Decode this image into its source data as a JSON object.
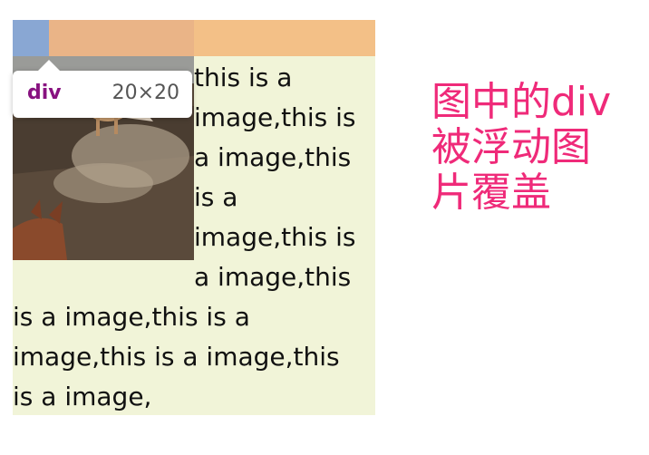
{
  "tooltip": {
    "tag": "div",
    "size": "20×20"
  },
  "paragraph_lines": [
    "this is a",
    "image,this is",
    "a image,this",
    "is a",
    "image,this is",
    "a image,this",
    "is a image,this is a",
    "image,this is a image,this",
    "is a image,"
  ],
  "annotation": {
    "lines": [
      "图中的div",
      "被浮动图",
      "片覆盖"
    ]
  },
  "colors": {
    "annotation": "#ef2a79",
    "tag": "#881280",
    "container_bg": "#f1f4d8",
    "margin_highlight": "#f3c087",
    "box_highlight": "#89a7d3"
  },
  "image": {
    "icon": "horse-rider-photo"
  }
}
